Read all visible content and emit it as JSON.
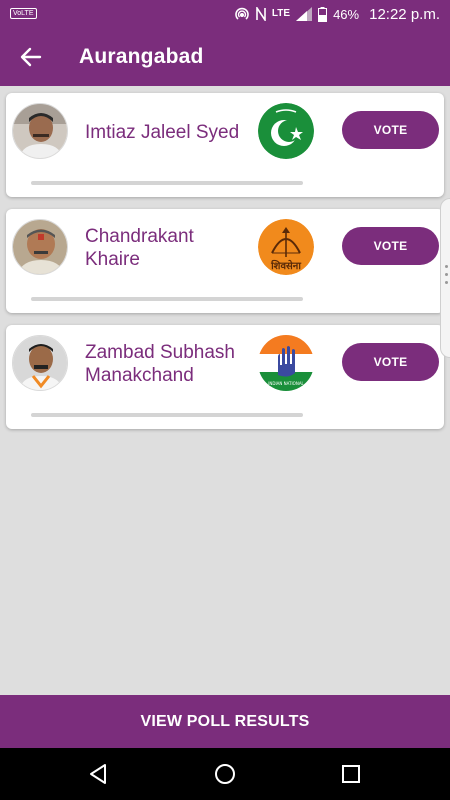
{
  "status_bar": {
    "volte": "VoLTE",
    "network": "LTE",
    "battery": "46%",
    "time": "12:22 p.m."
  },
  "app_bar": {
    "title": "Aurangabad",
    "back_icon": "arrow-left-icon"
  },
  "candidates": [
    {
      "name_line1": "Imtiaz Jaleel Syed",
      "name_line2": "",
      "vote_label": "VOTE",
      "party_logo": "aimim-crescent-icon",
      "vote_share": 0
    },
    {
      "name_line1": "Chandrakant",
      "name_line2": "Khaire",
      "vote_label": "VOTE",
      "party_logo": "shivsena-bow-arrow-icon",
      "party_text": "शिवसेना",
      "vote_share": 0
    },
    {
      "name_line1": "Zambad Subhash",
      "name_line2": "Manakchand",
      "vote_label": "VOTE",
      "party_logo": "congress-hand-icon",
      "party_text": "INDIAN NATIONAL",
      "vote_share": 0
    }
  ],
  "results_button": "VIEW POLL RESULTS",
  "nav": {
    "back": "back-triangle-icon",
    "home": "home-circle-icon",
    "recents": "recents-square-icon"
  },
  "colors": {
    "primary": "#7b2d7c",
    "background": "#dedede"
  }
}
